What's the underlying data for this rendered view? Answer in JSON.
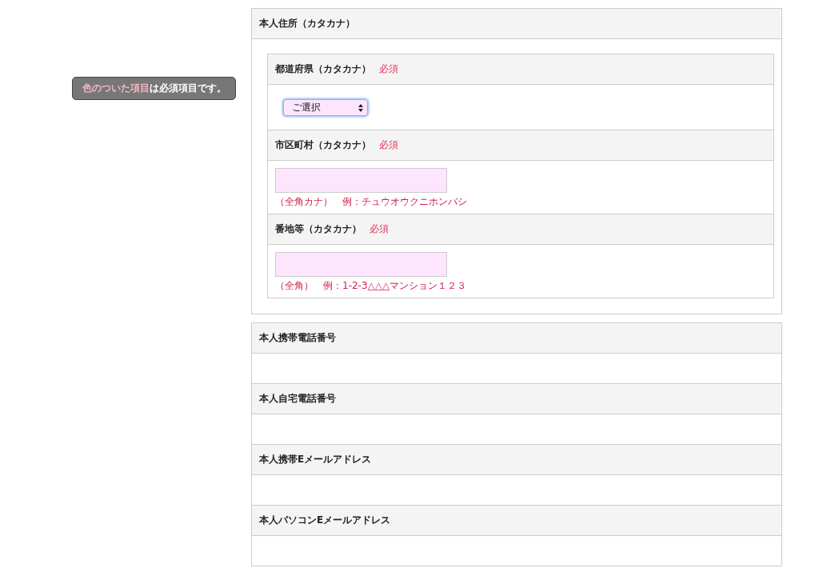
{
  "notice": {
    "highlight": "色のついた項目",
    "rest": "は必須項目です。"
  },
  "address": {
    "title": "本人住所（カタカナ）",
    "fields": [
      {
        "label": "都道府県（カタカナ）",
        "required": "必須",
        "kind": "select",
        "value": "ご選択"
      },
      {
        "label": "市区町村（カタカナ）",
        "required": "必須",
        "kind": "text",
        "hint": "（全角カナ）　例：チュウオウクニホンバシ"
      },
      {
        "label": "番地等（カタカナ）",
        "required": "必須",
        "kind": "text",
        "hint": "（全角）　例：1-2-3△△△マンション１２３"
      }
    ]
  },
  "sections": [
    {
      "title": "本人携帯電話番号"
    },
    {
      "title": "本人自宅電話番号"
    },
    {
      "title": "本人携帯Eメールアドレス"
    },
    {
      "title": "本人パソコンEメールアドレス"
    }
  ]
}
